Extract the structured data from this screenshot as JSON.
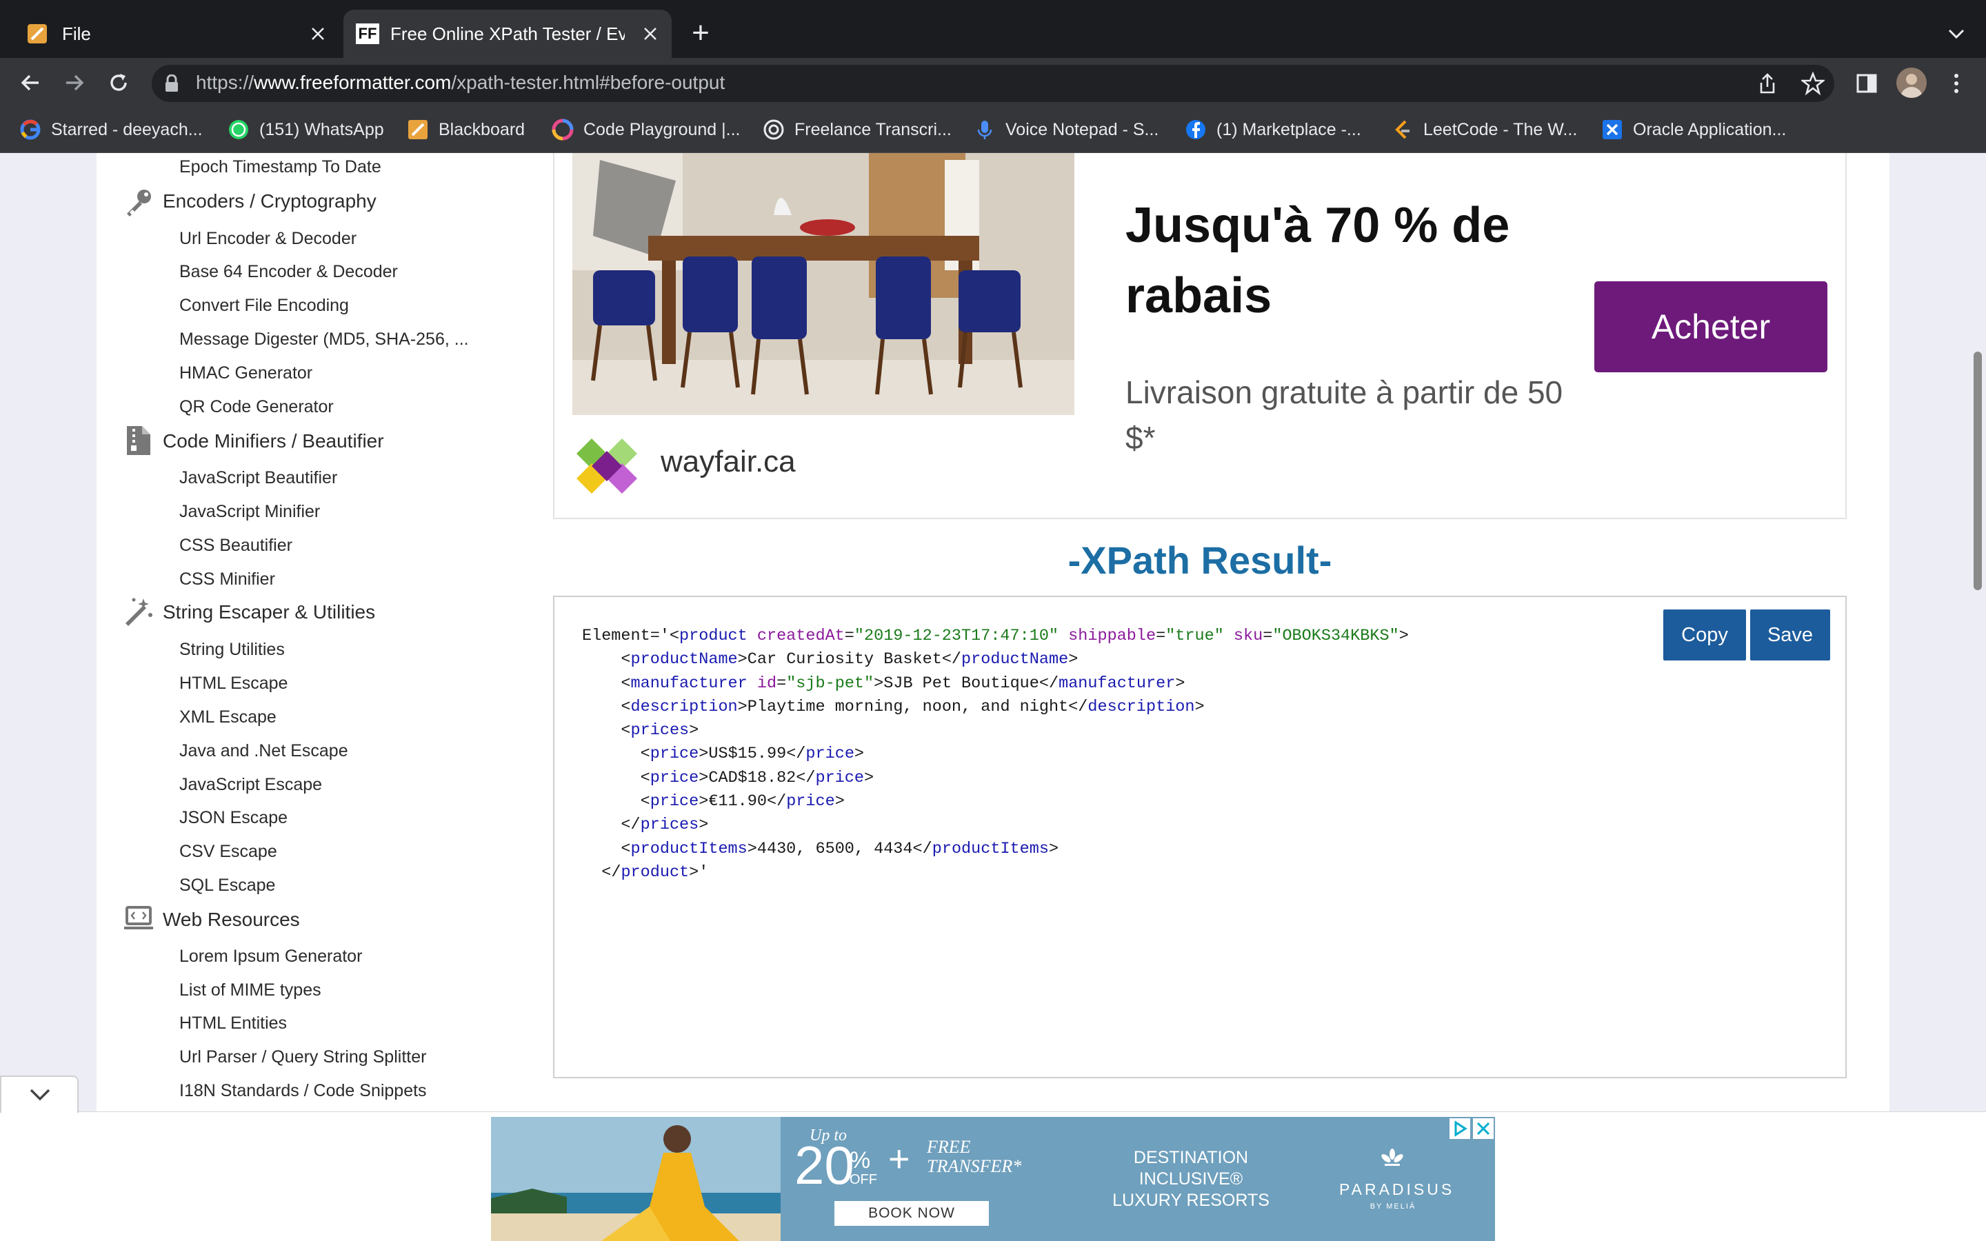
{
  "browser": {
    "tabs": [
      {
        "title": "File",
        "active": false
      },
      {
        "title": "Free Online XPath Tester / Eval",
        "active": true
      }
    ],
    "new_tab_symbol": "+",
    "url": {
      "scheme": "https://",
      "host": "www.freeformatter.com",
      "path": "/xpath-tester.html#before-output"
    },
    "bookmarks": [
      {
        "label": "Starred - deeyach...",
        "icon": "google-icon"
      },
      {
        "label": "(151) WhatsApp",
        "icon": "whatsapp-icon"
      },
      {
        "label": "Blackboard",
        "icon": "blackboard-icon"
      },
      {
        "label": "Code Playground |...",
        "icon": "code-playground-icon"
      },
      {
        "label": "Freelance Transcri...",
        "icon": "transcription-icon"
      },
      {
        "label": "Voice Notepad - S...",
        "icon": "microphone-icon"
      },
      {
        "label": "(1) Marketplace -...",
        "icon": "facebook-icon"
      },
      {
        "label": "LeetCode - The W...",
        "icon": "leetcode-icon"
      },
      {
        "label": "Oracle Application...",
        "icon": "oracle-icon"
      }
    ]
  },
  "sidebar": {
    "top_item": "Epoch Timestamp To Date",
    "sections": [
      {
        "title": "Encoders / Cryptography",
        "icon": "key-icon",
        "items": [
          "Url Encoder & Decoder",
          "Base 64 Encoder & Decoder",
          "Convert File Encoding",
          "Message Digester (MD5, SHA-256, ...",
          "HMAC Generator",
          "QR Code Generator"
        ]
      },
      {
        "title": "Code Minifiers / Beautifier",
        "icon": "zip-file-icon",
        "items": [
          "JavaScript Beautifier",
          "JavaScript Minifier",
          "CSS Beautifier",
          "CSS Minifier"
        ]
      },
      {
        "title": "String Escaper & Utilities",
        "icon": "magic-wand-icon",
        "items": [
          "String Utilities",
          "HTML Escape",
          "XML Escape",
          "Java and .Net Escape",
          "JavaScript Escape",
          "JSON Escape",
          "CSV Escape",
          "SQL Escape"
        ]
      },
      {
        "title": "Web Resources",
        "icon": "laptop-code-icon",
        "items": [
          "Lorem Ipsum Generator",
          "List of MIME types",
          "HTML Entities",
          "Url Parser / Query String Splitter",
          "I18N Standards / Code Snippets"
        ]
      }
    ]
  },
  "ad_top": {
    "headline": "Jusqu'à 70 % de rabais",
    "subtext": "Livraison gratuite à partir de 50 $*",
    "button": "Acheter",
    "brand": "wayfair.ca",
    "colors": {
      "button": "#6d1a7b"
    }
  },
  "result": {
    "title": "-XPath Result-",
    "copy_button": "Copy",
    "save_button": "Save",
    "code": {
      "l1_prefix": "Element='<",
      "l1_tag": "product",
      "l1_attr1": "createdAt",
      "l1_val1": "\"2019-12-23T17:47:10\"",
      "l1_attr2": "shippable",
      "l1_val2": "\"true\"",
      "l1_attr3": "sku",
      "l1_val3": "\"OBOKS34KBKS\"",
      "productName_tag": "productName",
      "productName_text": "Car Curiosity Basket",
      "manufacturer_tag": "manufacturer",
      "manufacturer_attr": "id",
      "manufacturer_val": "\"sjb-pet\"",
      "manufacturer_text": "SJB Pet Boutique",
      "description_tag": "description",
      "description_text": "Playtime morning, noon, and night",
      "prices_tag": "prices",
      "price_tag": "price",
      "price_values": [
        "US$15.99",
        "CAD$18.82",
        "€11.90"
      ],
      "productItems_tag": "productItems",
      "productItems_text": "4430, 6500, 4434",
      "closing_suffix": ">'"
    }
  },
  "ad_bottom": {
    "up_to": "Up to",
    "percent": "20",
    "percent_sign": "%",
    "off": "OFF",
    "plus": "+",
    "free_transfer": "FREE TRANSFER*",
    "book_now": "BOOK NOW",
    "destination": "DESTINATION INCLUSIVE® LUXURY RESORTS",
    "brand": "PARADISUS",
    "brand_sub": "BY MELIÁ"
  }
}
